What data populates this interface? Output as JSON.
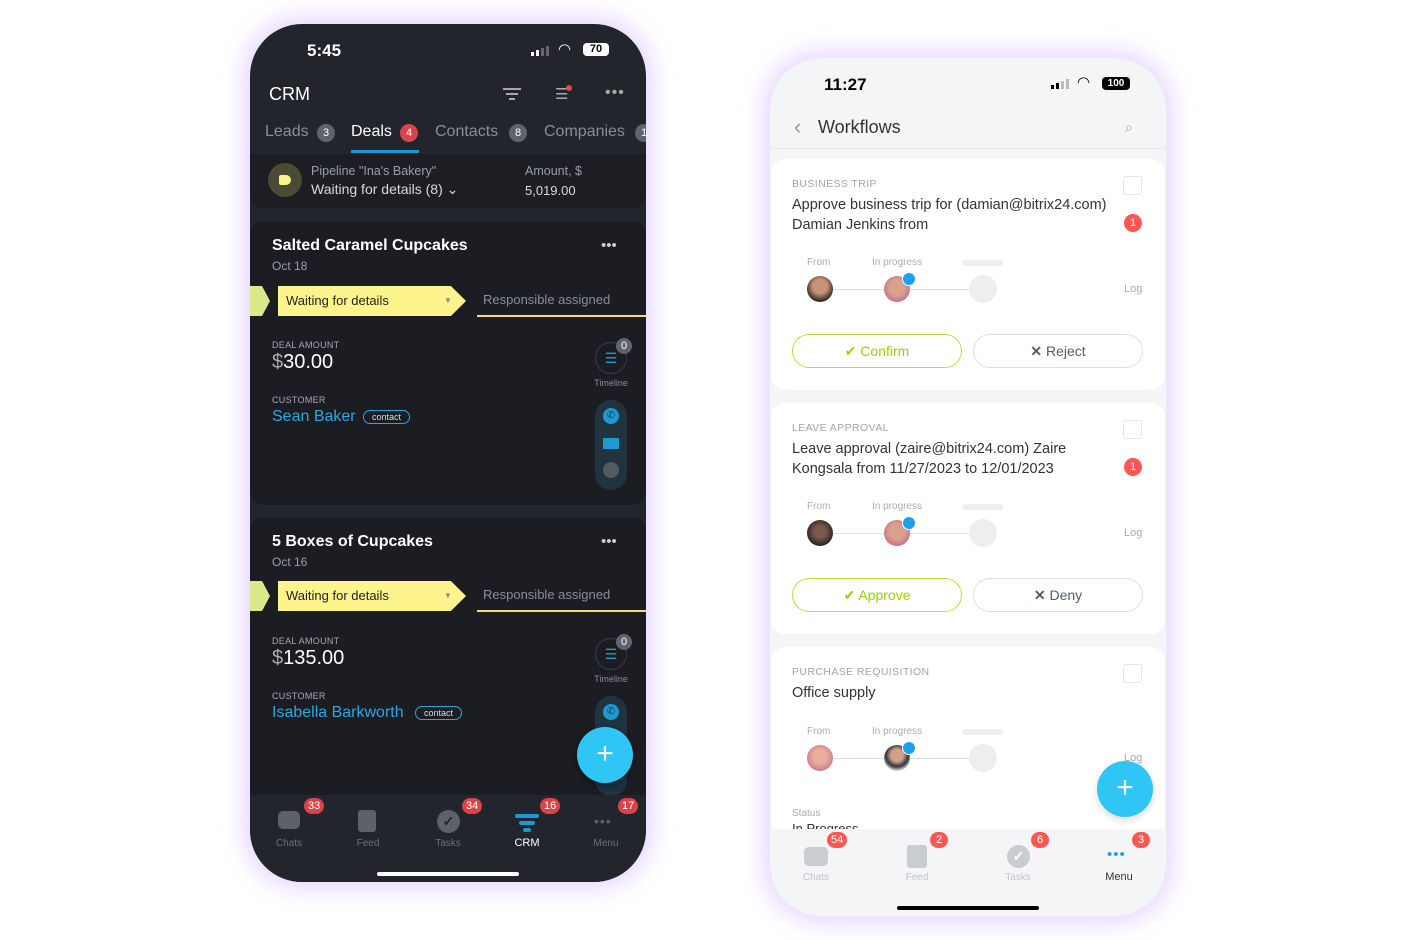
{
  "left_phone": {
    "status": {
      "time": "5:45",
      "battery": "70"
    },
    "header": {
      "title": "CRM",
      "icons": [
        "filter-icon",
        "search-notification-icon",
        "more-icon"
      ]
    },
    "tabs": [
      {
        "label": "Leads",
        "count": "3"
      },
      {
        "label": "Deals",
        "count": "4",
        "active": true
      },
      {
        "label": "Contacts",
        "count": "8"
      },
      {
        "label": "Companies",
        "count": "1"
      }
    ],
    "pipeline": {
      "name": "Pipeline \"Ina's Bakery\"",
      "stage": "Waiting for details (8)",
      "amount_label": "Amount, $",
      "amount": "5,019.00"
    },
    "deals": [
      {
        "title": "Salted Caramel Cupcakes",
        "date": "Oct 18",
        "stage": "Waiting for details",
        "next_stage": "Responsible assigned",
        "amount_label": "DEAL AMOUNT",
        "currency": "$",
        "amount": "30.00",
        "customer_label": "CUSTOMER",
        "customer": "Sean Baker",
        "customer_tag": "contact",
        "timeline_label": "Timeline",
        "timeline_count": "0"
      },
      {
        "title": "5 Boxes of Cupcakes",
        "date": "Oct 16",
        "stage": "Waiting for details",
        "next_stage": "Responsible assigned",
        "amount_label": "DEAL AMOUNT",
        "currency": "$",
        "amount": "135.00",
        "customer_label": "CUSTOMER",
        "customer": "Isabella Barkworth",
        "customer_tag": "contact",
        "timeline_label": "Timeline",
        "timeline_count": "0"
      }
    ],
    "nav": [
      {
        "label": "Chats",
        "badge": "33"
      },
      {
        "label": "Feed",
        "badge": ""
      },
      {
        "label": "Tasks",
        "badge": "34"
      },
      {
        "label": "CRM",
        "badge": "16",
        "active": true
      },
      {
        "label": "Menu",
        "badge": "17"
      }
    ],
    "colors": {
      "bg": "#22252b",
      "accent": "#2fc6f6",
      "link": "#2fa6e0",
      "stage": "#fdf48d"
    }
  },
  "right_phone": {
    "status": {
      "time": "11:27",
      "battery": "100"
    },
    "header": {
      "title": "Workflows"
    },
    "workflows": [
      {
        "type": "BUSINESS TRIP",
        "title": "Approve business trip for (damian@bitrix24.com) Damian Jenkins from",
        "count": "1",
        "from_label": "From",
        "progress_label": "In progress",
        "log": "Log",
        "approve": "Confirm",
        "reject": "Reject"
      },
      {
        "type": "LEAVE APPROVAL",
        "title": "Leave approval (zaire@bitrix24.com) Zaire Kongsala from 11/27/2023 to 12/01/2023",
        "count": "1",
        "from_label": "From",
        "progress_label": "In progress",
        "log": "Log",
        "approve": "Approve",
        "reject": "Deny"
      },
      {
        "type": "PURCHASE REQUISITION",
        "title": "Office supply",
        "from_label": "From",
        "progress_label": "In progress",
        "log": "Log",
        "status_label": "Status",
        "status": "In Progress"
      }
    ],
    "nav": [
      {
        "label": "Chats",
        "badge": "54"
      },
      {
        "label": "Feed",
        "badge": "2"
      },
      {
        "label": "Tasks",
        "badge": "6"
      },
      {
        "label": "Menu",
        "badge": "3",
        "active": true
      }
    ],
    "colors": {
      "approve": "#9dcf00",
      "fab": "#2fc6f6",
      "badge": "#ff5752"
    }
  }
}
